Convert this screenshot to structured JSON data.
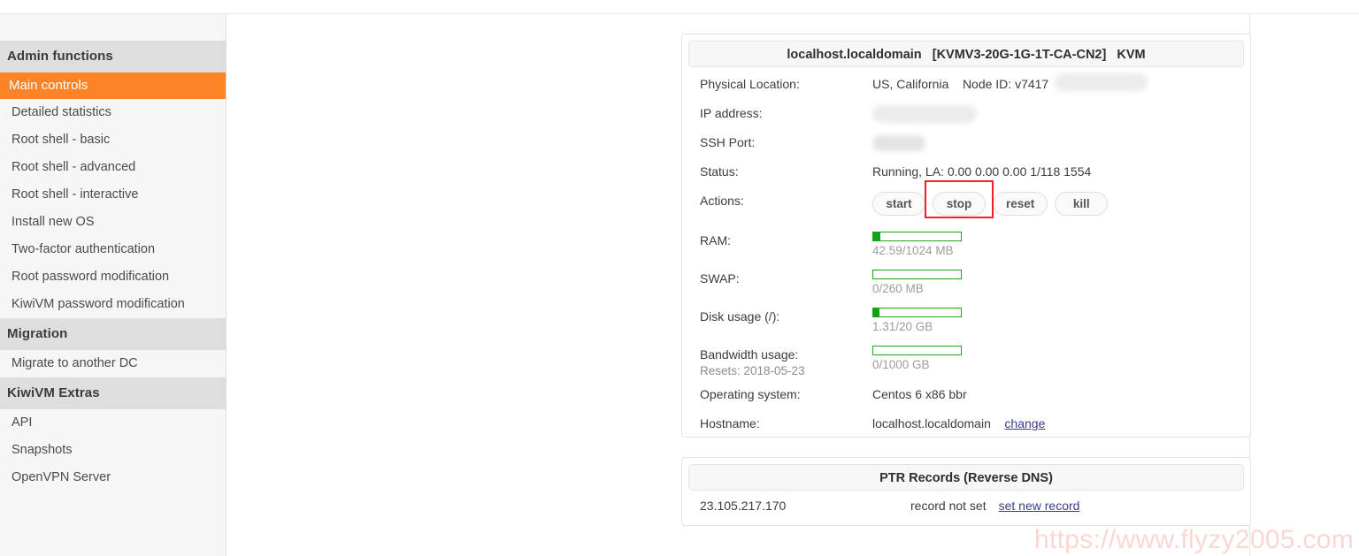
{
  "sidebar": {
    "sections": [
      {
        "title": "Admin functions",
        "items": [
          {
            "label": "Main controls",
            "active": true
          },
          {
            "label": "Detailed statistics",
            "active": false
          },
          {
            "label": "Root shell - basic",
            "active": false
          },
          {
            "label": "Root shell - advanced",
            "active": false
          },
          {
            "label": "Root shell - interactive",
            "active": false
          },
          {
            "label": "Install new OS",
            "active": false
          },
          {
            "label": "Two-factor authentication",
            "active": false
          },
          {
            "label": "Root password modification",
            "active": false
          },
          {
            "label": "KiwiVM password modification",
            "active": false
          }
        ]
      },
      {
        "title": "Migration",
        "items": [
          {
            "label": "Migrate to another DC",
            "active": false
          }
        ]
      },
      {
        "title": "KiwiVM Extras",
        "items": [
          {
            "label": "API",
            "active": false
          },
          {
            "label": "Snapshots",
            "active": false
          },
          {
            "label": "OpenVPN Server",
            "active": false
          }
        ]
      }
    ]
  },
  "main_panel": {
    "header": "localhost.localdomain   [KVMV3-20G-1G-1T-CA-CN2]   KVM",
    "labels": {
      "physical_location": "Physical Location:",
      "ip_address": "IP address:",
      "ssh_port": "SSH Port:",
      "status": "Status:",
      "actions": "Actions:",
      "ram": "RAM:",
      "swap": "SWAP:",
      "disk": "Disk usage (/):",
      "bandwidth": "Bandwidth usage:",
      "bandwidth_reset": "Resets: 2018-05-23",
      "os": "Operating system:",
      "hostname": "Hostname:"
    },
    "values": {
      "physical_location": "US, California",
      "node_id": "Node ID: v7417",
      "status": "Running, LA: 0.00 0.00 0.00 1/118 1554",
      "os": "Centos 6 x86 bbr",
      "hostname": "localhost.localdomain",
      "hostname_change_link": "change"
    },
    "buttons": {
      "start": "start",
      "stop": "stop",
      "reset": "reset",
      "kill": "kill"
    },
    "highlight": {
      "target": "stop",
      "color": "#f3202a"
    },
    "meters": {
      "ram": {
        "text": "42.59/1024 MB",
        "percent": 8
      },
      "swap": {
        "text": "0/260 MB",
        "percent": 0
      },
      "disk": {
        "text": "1.31/20 GB",
        "percent": 7
      },
      "bandwidth": {
        "text": "0/1000 GB",
        "percent": 0
      }
    },
    "meter_color": "#14a014"
  },
  "ptr_panel": {
    "header": "PTR Records (Reverse DNS)",
    "rows": [
      {
        "ip": "23.105.217.170",
        "state": "record not set",
        "link": "set new record"
      }
    ]
  },
  "watermark": "https://www.flyzy2005.com",
  "colors": {
    "accent_orange": "#fb8429",
    "group_bg": "#dededf",
    "sidebar_bg": "#f6f6f6",
    "highlight_red": "#f3202a",
    "link": "#3d3d8f",
    "watermark": "#fbd7d3"
  }
}
